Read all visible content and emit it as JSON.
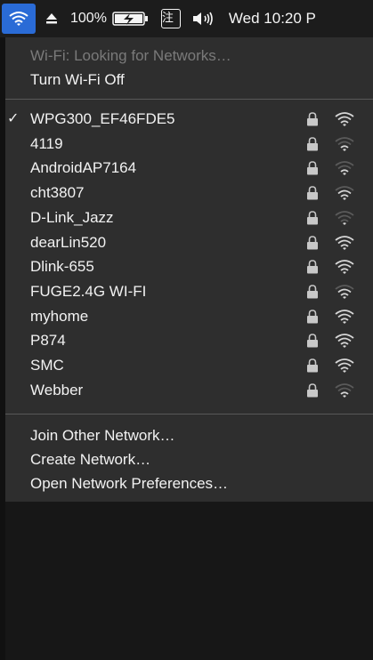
{
  "menubar": {
    "wifi_icon": "wifi-icon",
    "eject_icon": "eject-icon",
    "battery_percent": "100%",
    "battery_level": 1.0,
    "battery_icon": "battery-charging-icon",
    "input_method": "注",
    "volume_icon": "volume-icon",
    "clock": "Wed 10:20 P",
    "accent_color": "#2a6bd6"
  },
  "wifi_menu": {
    "status": "Wi-Fi: Looking for Networks…",
    "toggle": "Turn Wi-Fi Off",
    "networks": [
      {
        "name": "WPG300_EF46FDE5",
        "connected": true,
        "secured": true,
        "strength": 4
      },
      {
        "name": "4119",
        "connected": false,
        "secured": true,
        "strength": 2
      },
      {
        "name": "AndroidAP7164",
        "connected": false,
        "secured": true,
        "strength": 2
      },
      {
        "name": "cht3807",
        "connected": false,
        "secured": true,
        "strength": 3
      },
      {
        "name": "D-Link_Jazz",
        "connected": false,
        "secured": true,
        "strength": 1
      },
      {
        "name": "dearLin520",
        "connected": false,
        "secured": true,
        "strength": 4
      },
      {
        "name": "Dlink-655",
        "connected": false,
        "secured": true,
        "strength": 4
      },
      {
        "name": "FUGE2.4G WI-FI",
        "connected": false,
        "secured": true,
        "strength": 3
      },
      {
        "name": "myhome",
        "connected": false,
        "secured": true,
        "strength": 4
      },
      {
        "name": "P874",
        "connected": false,
        "secured": true,
        "strength": 4
      },
      {
        "name": "SMC",
        "connected": false,
        "secured": true,
        "strength": 4
      },
      {
        "name": "Webber",
        "connected": false,
        "secured": true,
        "strength": 2
      }
    ],
    "actions": {
      "join_other": "Join Other Network…",
      "create": "Create Network…",
      "preferences": "Open Network Preferences…"
    }
  }
}
